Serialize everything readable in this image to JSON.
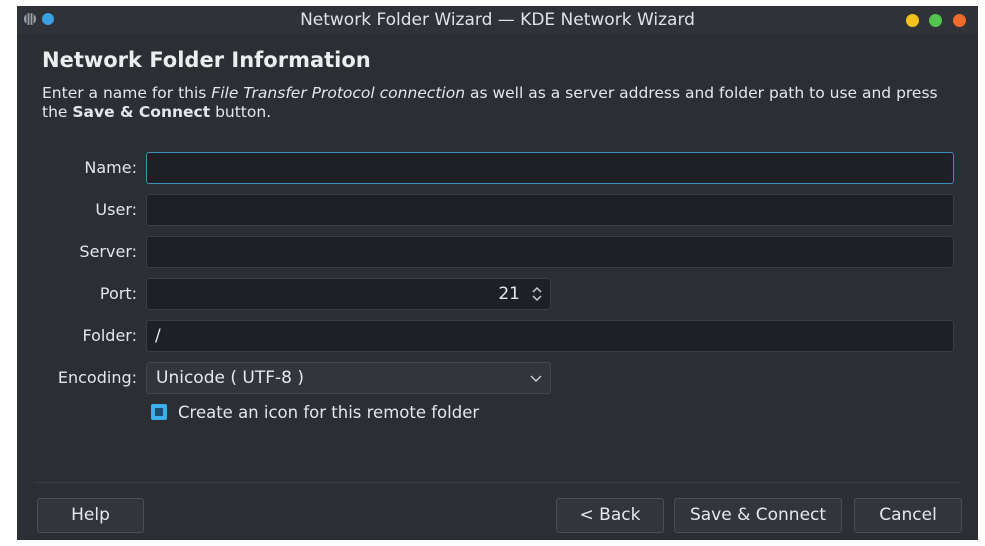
{
  "window": {
    "title": "Network Folder Wizard — KDE Network Wizard",
    "controls": [
      "minimize",
      "maximize",
      "close"
    ]
  },
  "page": {
    "heading": "Network Folder Information",
    "intro": {
      "part1": "Enter a name for this ",
      "protocol": "File Transfer Protocol connection",
      "part2": " as well as a server address and folder path to use and press the ",
      "button_ref": "Save & Connect",
      "part3": " button."
    }
  },
  "form": {
    "name": {
      "label": "Name:",
      "value": ""
    },
    "user": {
      "label": "User:",
      "value": ""
    },
    "server": {
      "label": "Server:",
      "value": ""
    },
    "port": {
      "label": "Port:",
      "value": "21"
    },
    "folder": {
      "label": "Folder:",
      "value": "/"
    },
    "encoding": {
      "label": "Encoding:",
      "value": "Unicode ( UTF-8 )"
    },
    "create_icon": {
      "label": "Create an icon for this remote folder",
      "checked": true
    }
  },
  "buttons": {
    "help": "Help",
    "back": "< Back",
    "save_connect": "Save & Connect",
    "cancel": "Cancel"
  },
  "colors": {
    "window_bg": "#2b2e33",
    "field_bg": "#1d2024",
    "accent": "#3daee9"
  }
}
